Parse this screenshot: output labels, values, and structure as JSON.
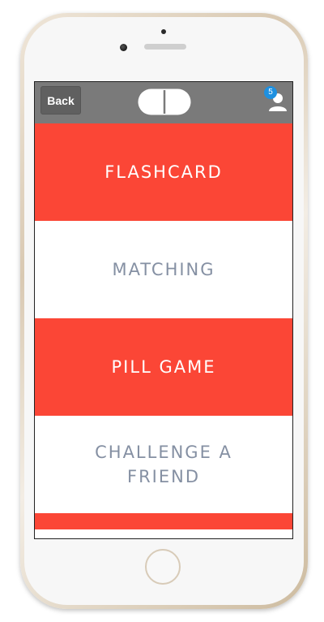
{
  "navbar": {
    "back_label": "Back",
    "logo_icon": "pill-logo-icon",
    "profile_icon": "user-icon",
    "notification_count": "5"
  },
  "menu": {
    "items": [
      {
        "label": "FLASHCARD",
        "style": "red"
      },
      {
        "label": "MATCHING",
        "style": "white"
      },
      {
        "label": "PILL GAME",
        "style": "red"
      },
      {
        "label": "CHALLENGE A FRIEND",
        "style": "white"
      },
      {
        "label": "",
        "style": "red"
      }
    ]
  },
  "colors": {
    "accent_red": "#fb4636",
    "navbar_gray": "#7a7a7a",
    "muted_text": "#8590a3",
    "badge_blue": "#1e90e0"
  }
}
